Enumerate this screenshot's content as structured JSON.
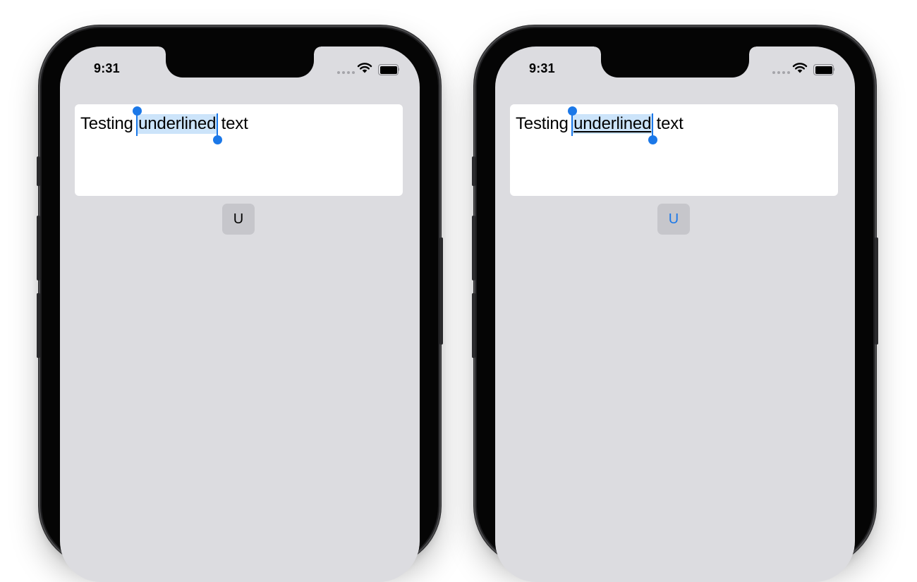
{
  "phones": [
    {
      "status_bar": {
        "time": "9:31",
        "wifi_icon": "wifi-icon",
        "battery_icon": "battery-icon"
      },
      "editor": {
        "text_before": "Testing ",
        "selected_text": "underlined",
        "text_after": " text",
        "selection_underlined": false
      },
      "underline_button": {
        "label": "U",
        "active": false
      }
    },
    {
      "status_bar": {
        "time": "9:31",
        "wifi_icon": "wifi-icon",
        "battery_icon": "battery-icon"
      },
      "editor": {
        "text_before": "Testing ",
        "selected_text": "underlined",
        "text_after": " text",
        "selection_underlined": true
      },
      "underline_button": {
        "label": "U",
        "active": true
      }
    }
  ],
  "colors": {
    "accent": "#1b78e8",
    "selection_highlight": "#cce4fa",
    "screen_background": "#dcdce0",
    "button_background": "#c6c6cb"
  }
}
